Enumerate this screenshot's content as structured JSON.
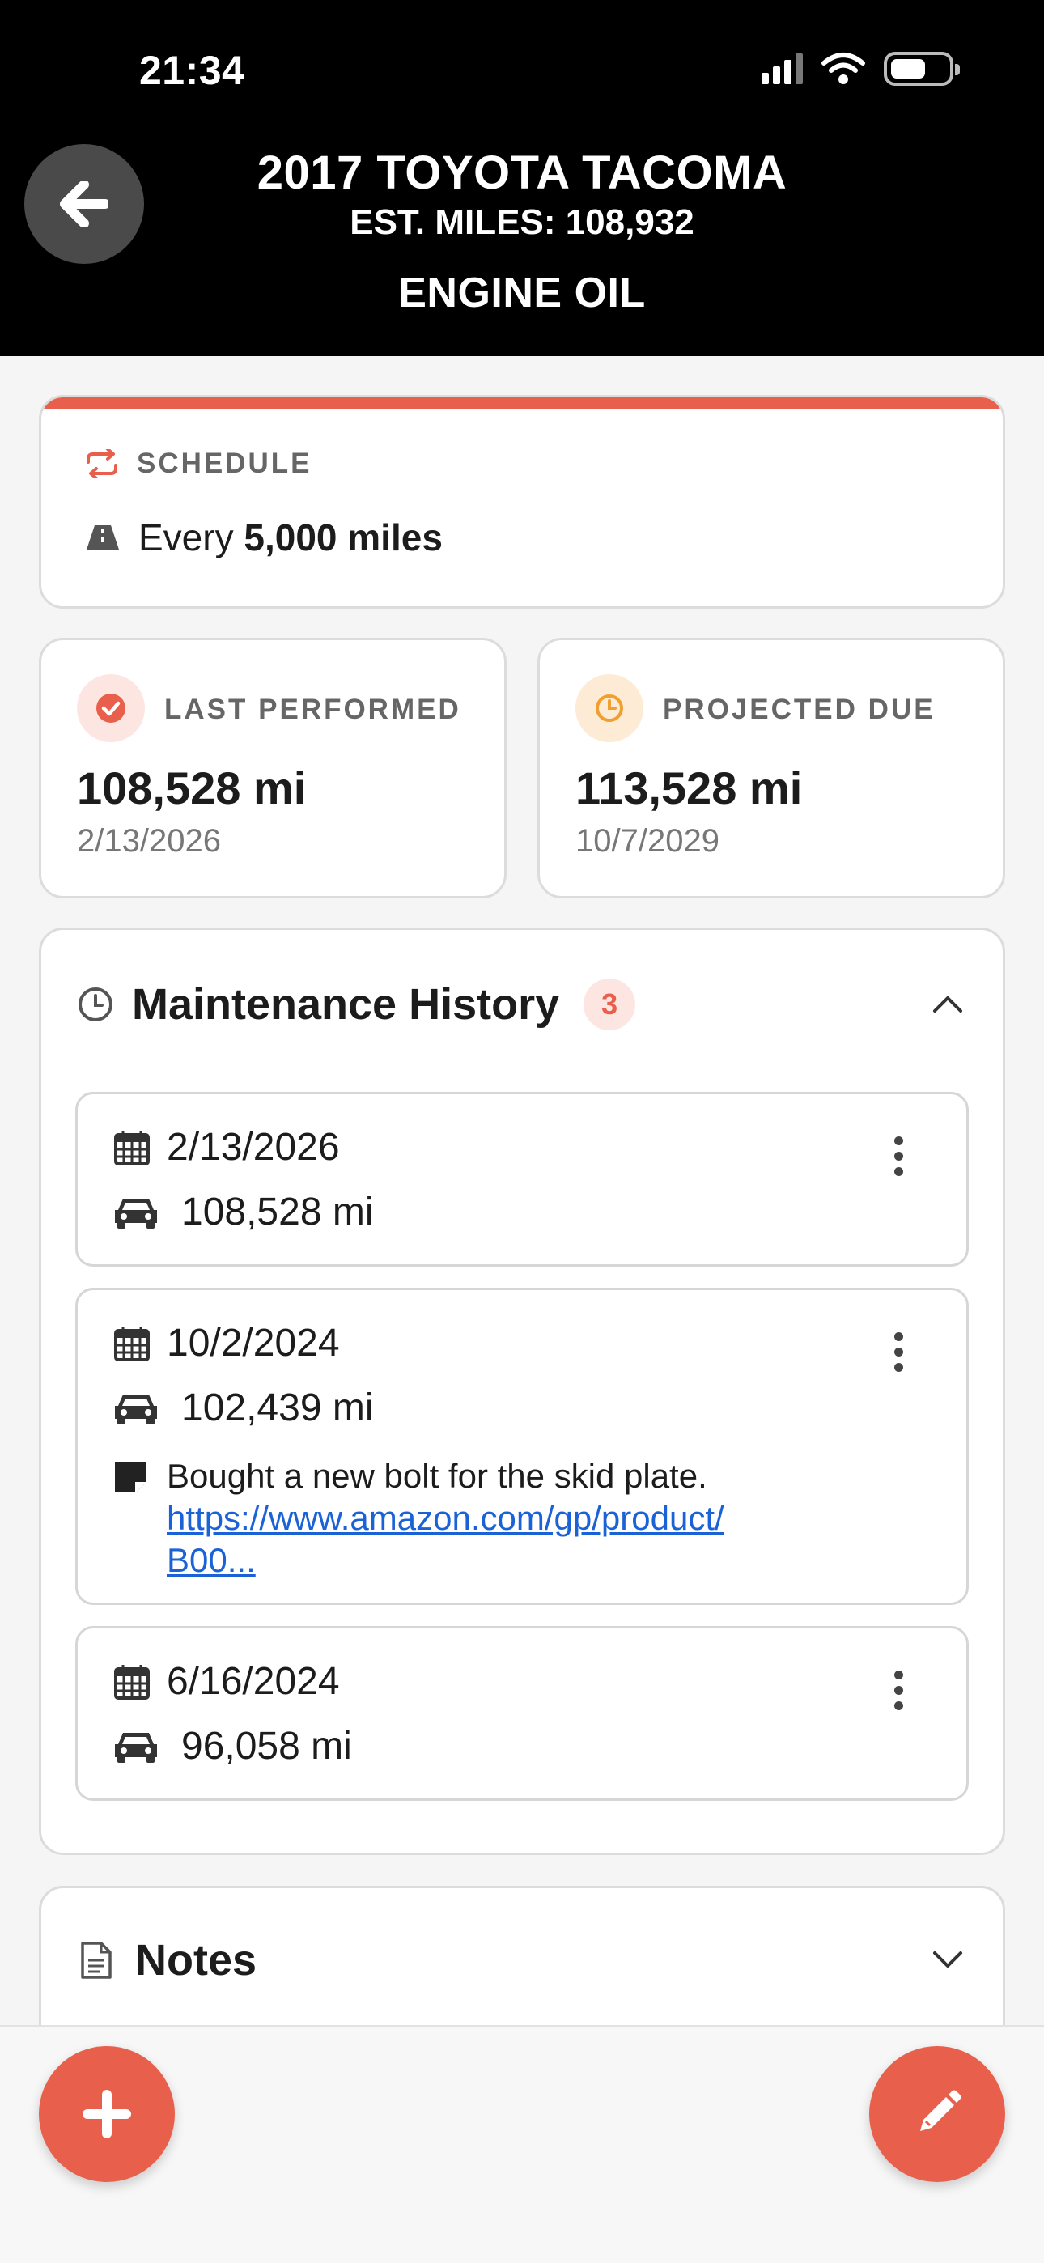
{
  "status_bar": {
    "time": "21:34"
  },
  "header": {
    "vehicle": "2017 TOYOTA TACOMA",
    "est_miles": "EST. MILES: 108,932",
    "item": "ENGINE OIL"
  },
  "schedule": {
    "label": "SCHEDULE",
    "prefix": "Every",
    "value": "5,000 miles"
  },
  "last_performed": {
    "label": "LAST PERFORMED",
    "miles": "108,528 mi",
    "date": "2/13/2026"
  },
  "projected_due": {
    "label": "PROJECTED DUE",
    "miles": "113,528 mi",
    "date": "10/7/2029"
  },
  "history": {
    "title": "Maintenance History",
    "count": "3",
    "entries": [
      {
        "date": "2/13/2026",
        "miles": "108,528 mi"
      },
      {
        "date": "10/2/2024",
        "miles": "102,439 mi",
        "note": "Bought a new bolt for the skid plate.",
        "link": "https://www.amazon.com/gp/product/",
        "link2": "B00..."
      },
      {
        "date": "6/16/2024",
        "miles": "96,058 mi"
      }
    ]
  },
  "notes": {
    "title": "Notes"
  },
  "colors": {
    "accent": "#e8604c",
    "link": "#1a62d6",
    "due_icon": "#f0a030"
  }
}
